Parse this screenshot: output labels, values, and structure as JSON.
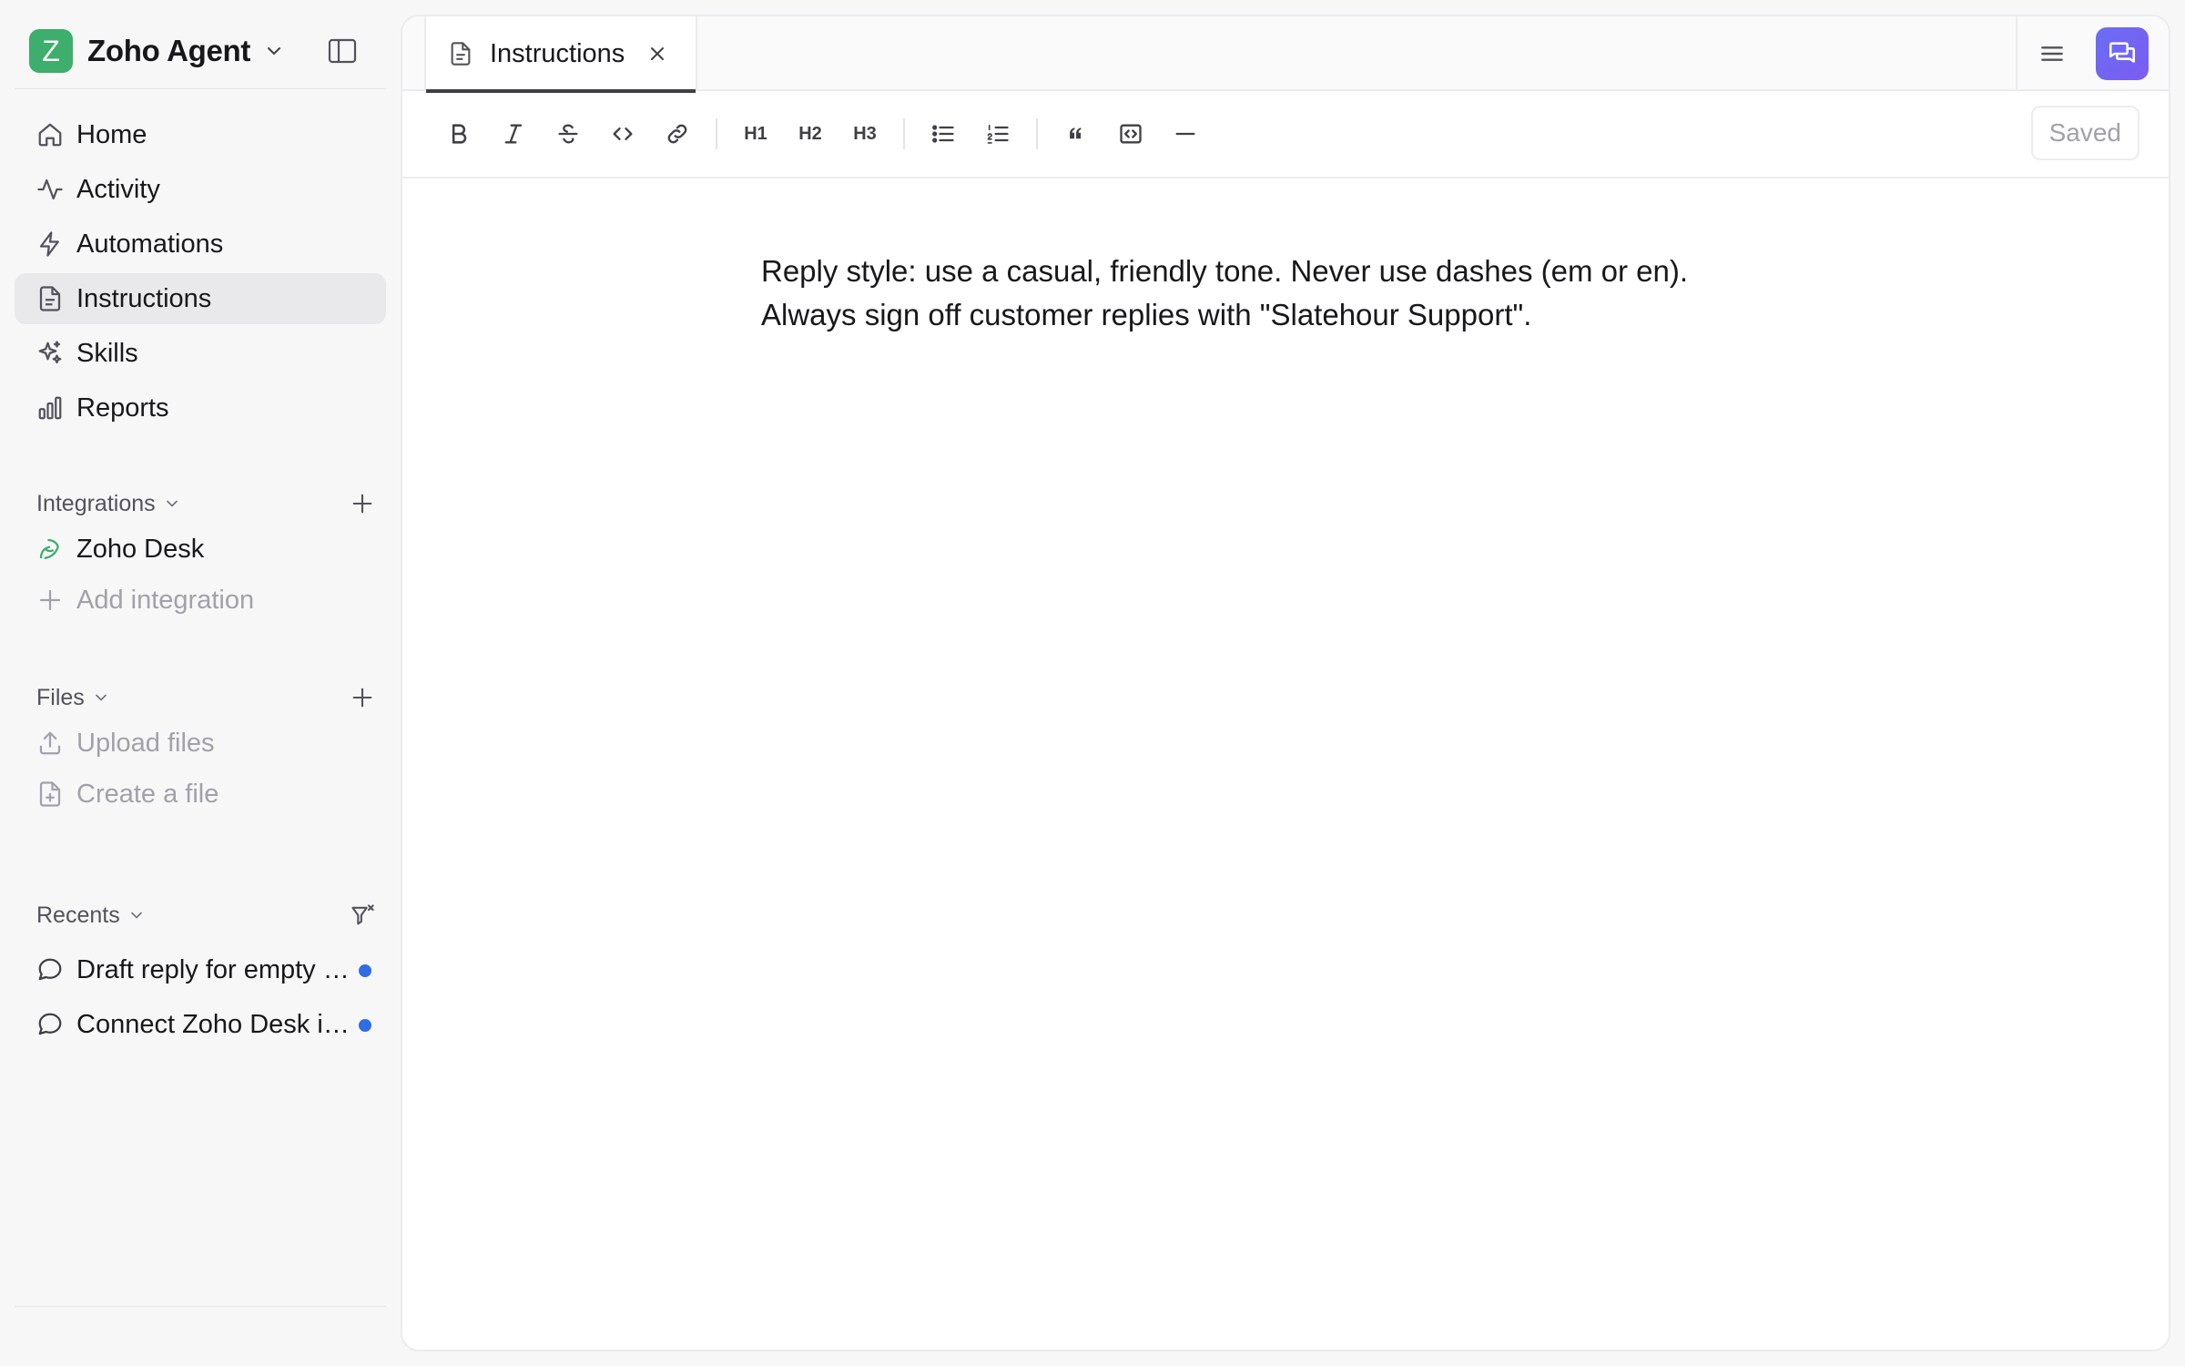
{
  "workspace": {
    "logo_letter": "Z",
    "name": "Zoho Agent"
  },
  "nav": [
    {
      "label": "Home",
      "icon": "home-icon"
    },
    {
      "label": "Activity",
      "icon": "activity-icon"
    },
    {
      "label": "Automations",
      "icon": "lightning-icon"
    },
    {
      "label": "Instructions",
      "icon": "document-icon",
      "active": true
    },
    {
      "label": "Skills",
      "icon": "sparkles-icon"
    },
    {
      "label": "Reports",
      "icon": "bar-chart-icon"
    }
  ],
  "integrations": {
    "title": "Integrations",
    "items": [
      {
        "label": "Zoho Desk",
        "icon": "zoho-desk-icon"
      }
    ],
    "add_label": "Add integration"
  },
  "files": {
    "title": "Files",
    "upload_label": "Upload files",
    "create_label": "Create a file"
  },
  "recents": {
    "title": "Recents",
    "items": [
      {
        "label": "Draft reply for empty ticket",
        "unread": true
      },
      {
        "label": "Connect Zoho Desk integration",
        "unread": true
      }
    ]
  },
  "tab": {
    "label": "Instructions"
  },
  "toolbar": {
    "h1": "H1",
    "h2": "H2",
    "h3": "H3",
    "saved_label": "Saved"
  },
  "editor": {
    "content": "Reply style: use a casual, friendly tone. Never use dashes (em or en). Always sign off customer replies with \"Slatehour Support\"."
  },
  "colors": {
    "logo": "#3dae6b",
    "accent": "#7b5cf0",
    "unread_dot": "#2f6de6",
    "active_bg": "#e9e9ec"
  }
}
